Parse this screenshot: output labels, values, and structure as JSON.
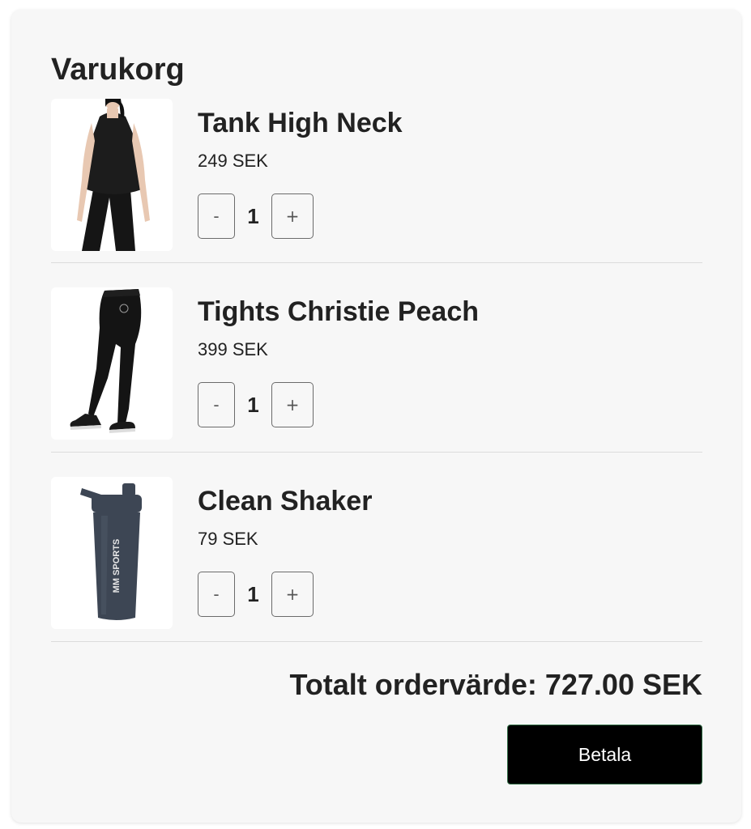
{
  "cart": {
    "title": "Varukorg",
    "items": [
      {
        "image_icon": "tank-top-product-image",
        "name": "Tank High Neck",
        "price": "249 SEK",
        "quantity": "1",
        "minus_label": "-",
        "plus_label": "+"
      },
      {
        "image_icon": "tights-product-image",
        "name": "Tights Christie Peach",
        "price": "399 SEK",
        "quantity": "1",
        "minus_label": "-",
        "plus_label": "+"
      },
      {
        "image_icon": "shaker-product-image",
        "name": "Clean Shaker",
        "price": "79 SEK",
        "quantity": "1",
        "minus_label": "-",
        "plus_label": "+"
      }
    ],
    "total_label": "Totalt ordervärde: 727.00 SEK",
    "pay_label": "Betala",
    "shaker_logo_text": "MM SPORTS"
  },
  "colors": {
    "card_background": "#f7f7f7",
    "pay_button": "#000000",
    "pay_button_border": "#2f6b43",
    "shaker_body": "#3d4654"
  }
}
